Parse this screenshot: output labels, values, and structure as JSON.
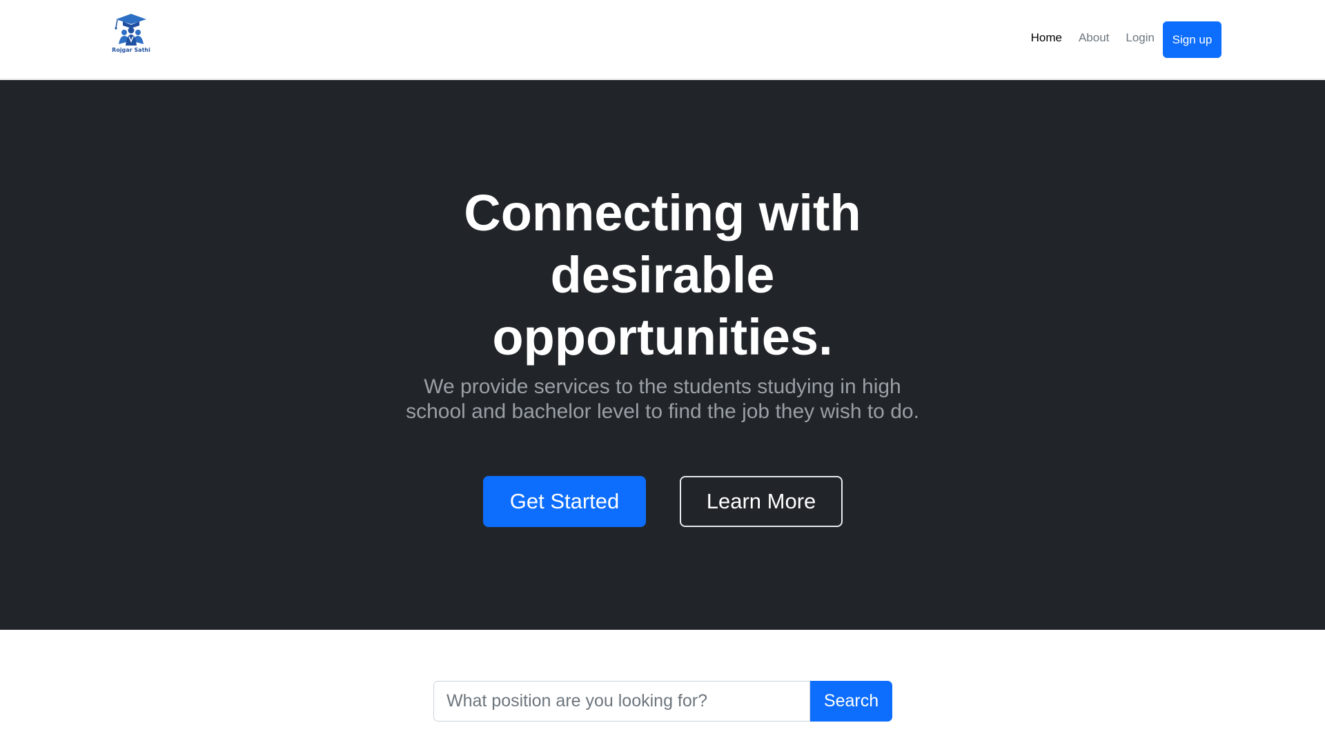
{
  "brand": {
    "logo_text": "Rojgar Sathi",
    "logo_icon": "graduation-cap-people-icon",
    "logo_color": "#1f4fa0"
  },
  "nav": {
    "items": [
      {
        "label": "Home",
        "active": true
      },
      {
        "label": "About",
        "active": false
      },
      {
        "label": "Login",
        "active": false
      }
    ],
    "signup_label": "Sign up"
  },
  "hero": {
    "title": "Connecting with desirable opportunities.",
    "subtitle": "We provide services to the students studying in high school and bachelor level to find the job they wish to do.",
    "primary_label": "Get Started",
    "secondary_label": "Learn More"
  },
  "search": {
    "placeholder": "What position are you looking for?",
    "value": "",
    "button_label": "Search"
  },
  "colors": {
    "accent": "#0d6efd",
    "hero_bg": "#212529",
    "muted_text": "#6c757d"
  }
}
